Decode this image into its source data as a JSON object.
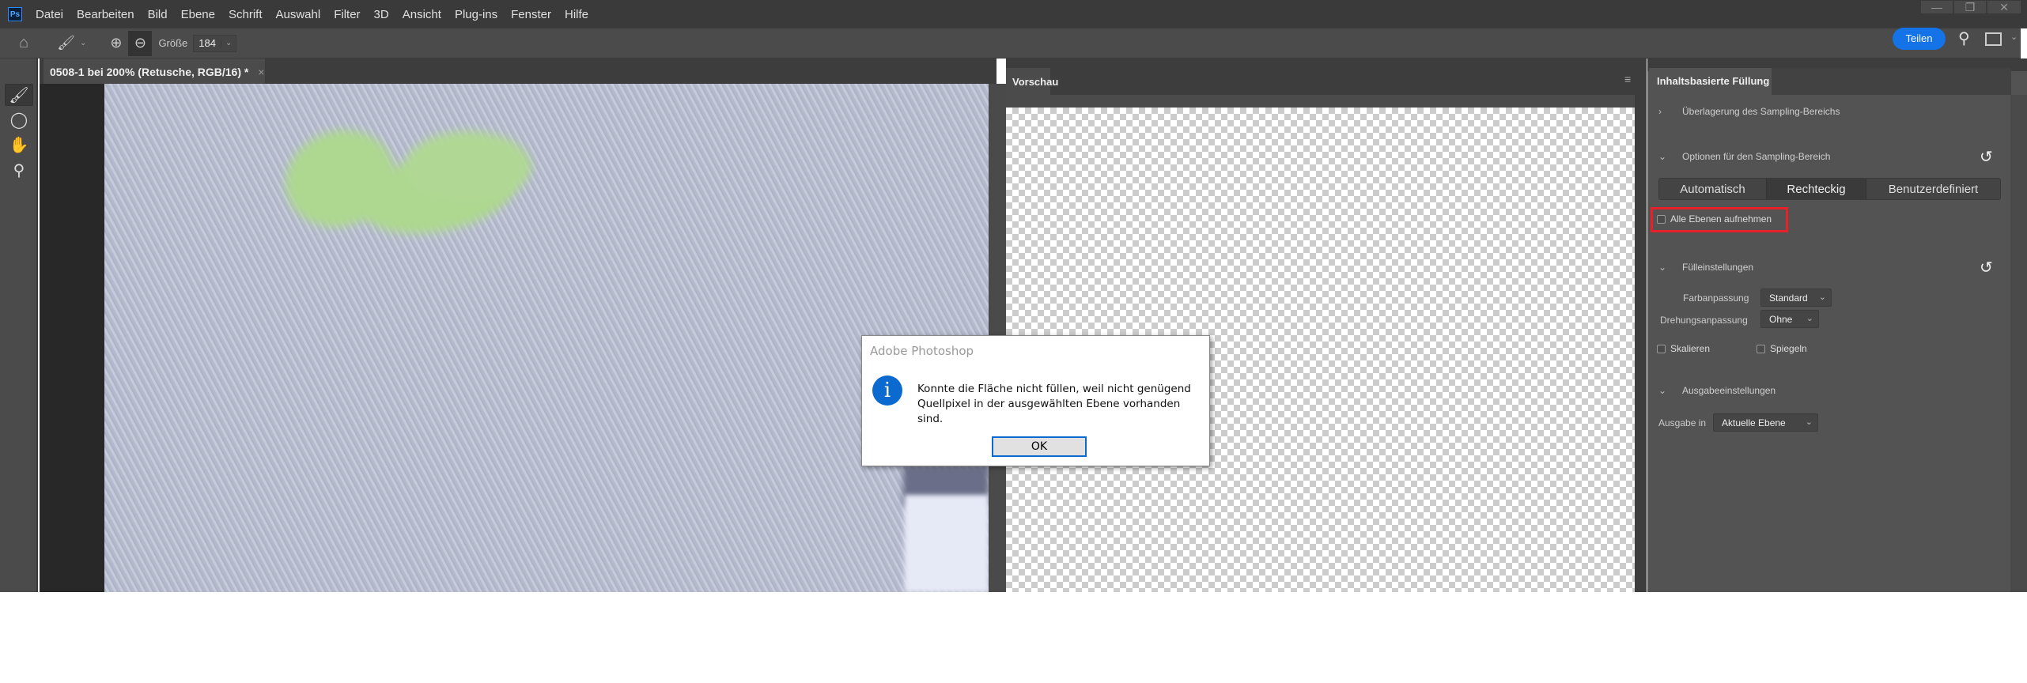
{
  "menubar": {
    "logo": "Ps",
    "items": [
      "Datei",
      "Bearbeiten",
      "Bild",
      "Ebene",
      "Schrift",
      "Auswahl",
      "Filter",
      "3D",
      "Ansicht",
      "Plug-ins",
      "Fenster",
      "Hilfe"
    ]
  },
  "options_bar": {
    "size_label": "Größe",
    "size_value": "184",
    "share_label": "Teilen"
  },
  "document_tab": {
    "title": "0508-1 bei 200% (Retusche, RGB/16) *",
    "close": "×"
  },
  "preview_panel": {
    "tab": "Vorschau"
  },
  "fill_panel": {
    "tab": "Inhaltsbasierte Füllung",
    "section_overlay": "Überlagerung des Sampling-Bereichs",
    "section_sampling": "Optionen für den Sampling-Bereich",
    "sampling_modes": [
      "Automatisch",
      "Rechteckig",
      "Benutzerdefiniert"
    ],
    "sampling_selected": "Rechteckig",
    "all_layers_label": "Alle Ebenen aufnehmen",
    "all_layers_checked": false,
    "section_fill": "Fülleinstellungen",
    "color_adapt_label": "Farbanpassung",
    "color_adapt_value": "Standard",
    "rotation_adapt_label": "Drehungsanpassung",
    "rotation_adapt_value": "Ohne",
    "scale_label": "Skalieren",
    "mirror_label": "Spiegeln",
    "section_output": "Ausgabeeinstellungen",
    "output_label": "Ausgabe in",
    "output_value": "Aktuelle Ebene"
  },
  "dialog": {
    "title": "Adobe Photoshop",
    "message_line1": "Konnte die Fläche nicht füllen, weil nicht genügend",
    "message_line2": "Quellpixel in der ausgewählten Ebene vorhanden sind.",
    "ok_label": "OK"
  },
  "colors": {
    "accent": "#1473e6",
    "highlight": "#e8202a",
    "info": "#0a6ad0"
  }
}
